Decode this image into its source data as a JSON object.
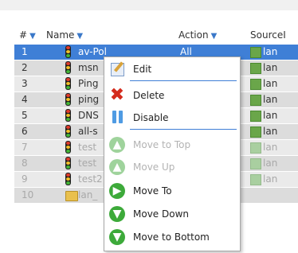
{
  "header": {
    "num": "#",
    "name": "Name",
    "action": "Action",
    "source": "SourceI"
  },
  "rows": [
    {
      "num": "1",
      "name": "av-Pol",
      "action": "All",
      "source": "lan",
      "state": "selected"
    },
    {
      "num": "2",
      "name": "msn",
      "action": "",
      "source": "lan",
      "state": "normal"
    },
    {
      "num": "3",
      "name": "Ping",
      "action": "",
      "source": "lan",
      "state": "normal"
    },
    {
      "num": "4",
      "name": "ping",
      "action": "",
      "source": "lan",
      "state": "normal"
    },
    {
      "num": "5",
      "name": "DNS",
      "action": "",
      "source": "lan",
      "state": "normal"
    },
    {
      "num": "6",
      "name": "all-s",
      "action": "",
      "source": "lan",
      "state": "normal"
    },
    {
      "num": "7",
      "name": "test",
      "action": "",
      "source": "lan",
      "state": "disabled"
    },
    {
      "num": "8",
      "name": "test",
      "action": "",
      "source": "lan",
      "state": "disabled"
    },
    {
      "num": "9",
      "name": "test2",
      "action": "",
      "source": "lan",
      "state": "disabled"
    },
    {
      "num": "10",
      "name": "lan_",
      "action": "",
      "source": "",
      "state": "disabled"
    }
  ],
  "menu": {
    "edit": "Edit",
    "delete": "Delete",
    "disable": "Disable",
    "move_top": "Move to Top",
    "move_up": "Move Up",
    "move_to": "Move To",
    "move_down": "Move Down",
    "move_bottom": "Move to Bottom"
  },
  "icons": {
    "sort": "triangle-down",
    "rule": "traffic-light",
    "group": "folder",
    "source": "network-object"
  },
  "colors": {
    "selection": "#3f7fd6",
    "sort_arrow": "#3a78c9",
    "delete_icon": "#d42a1c",
    "move_icon": "#3daa3a"
  }
}
